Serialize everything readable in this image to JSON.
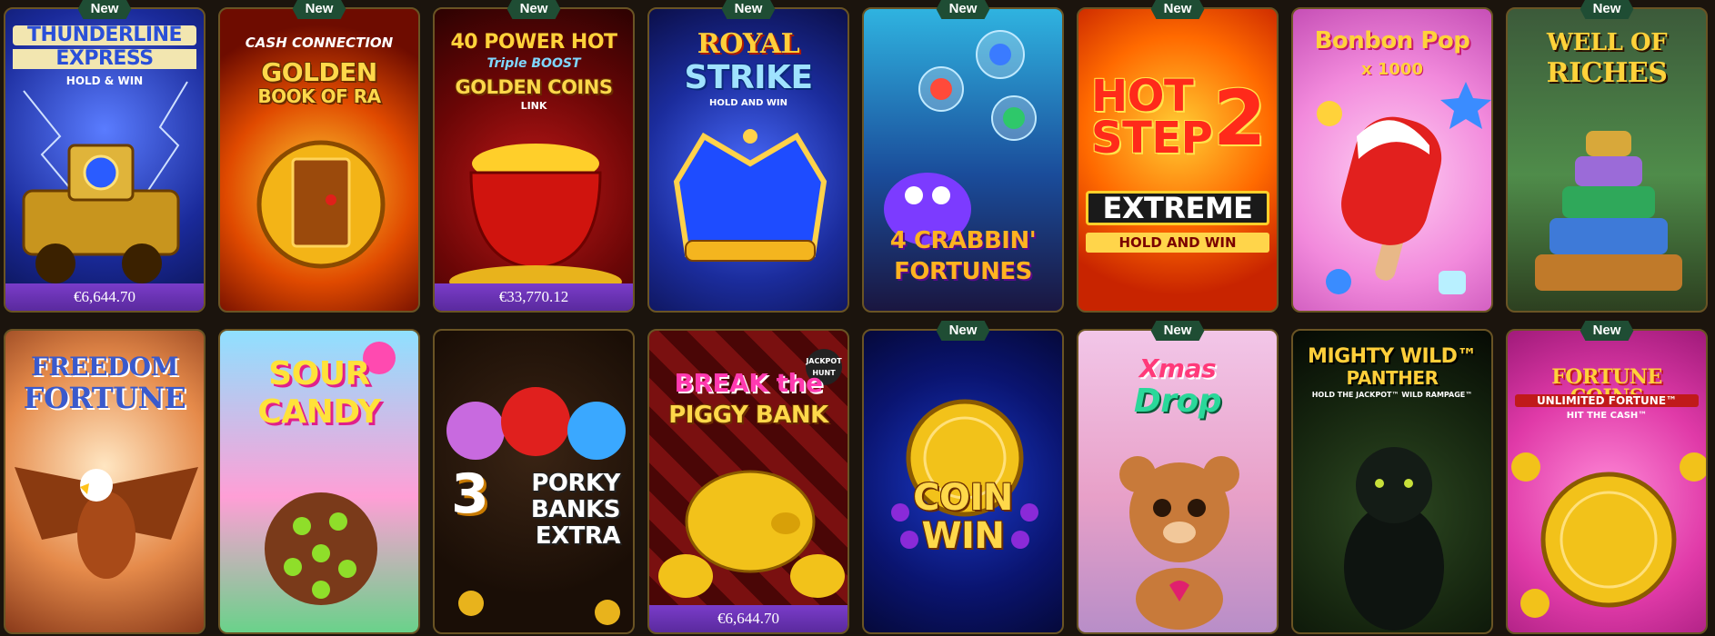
{
  "badge_new": "New",
  "games": [
    {
      "id": "thunderline",
      "title_line1": "THUNDERLINE",
      "title_line2": "EXPRESS",
      "subtitle": "HOLD & WIN",
      "jackpot": "€6,644.70",
      "is_new": true
    },
    {
      "id": "golden-book",
      "title_top": "CASH CONNECTION",
      "title_line1": "GOLDEN",
      "title_line2": "BOOK OF RA",
      "is_new": true
    },
    {
      "id": "power-hot",
      "title_line1": "40 POWER HOT",
      "title_line2": "Triple BOOST",
      "title_line3": "GOLDEN COINS",
      "title_line4": "LINK",
      "jackpot": "€33,770.12",
      "is_new": true
    },
    {
      "id": "royal-strike",
      "title_line1": "ROYAL",
      "title_line2": "STRIKE",
      "subtitle": "HOLD AND WIN",
      "is_new": true
    },
    {
      "id": "crabbin",
      "title_line1": "4 CRABBIN'",
      "title_line2": "FORTUNES",
      "is_new": true
    },
    {
      "id": "hot-step",
      "title_line1": "HOT",
      "title_line2": "STEP",
      "title_num": "2",
      "title_line3": "EXTREME",
      "subtitle": "HOLD AND WIN",
      "is_new": true
    },
    {
      "id": "bonbon",
      "title_line1": "Bonbon Pop",
      "title_line2": "x 1000",
      "is_new": false
    },
    {
      "id": "well-riches",
      "title_line1": "WELL OF",
      "title_line2": "RICHES",
      "is_new": true
    },
    {
      "id": "freedom",
      "title_line1": "FREEDOM",
      "title_line2": "FORTUNE",
      "is_new": false
    },
    {
      "id": "sour-candy",
      "title_line1": "SOUR",
      "title_line2": "CANDY",
      "is_new": false
    },
    {
      "id": "porky",
      "title_num": "3",
      "title_line1": "PORKY",
      "title_line2": "BANKS",
      "title_line3": "EXTRA",
      "is_new": false
    },
    {
      "id": "piggy",
      "title_line1": "BREAK the",
      "title_line2": "PIGGY BANK",
      "corner": "JACKPOT HUNT",
      "jackpot": "€6,644.70",
      "is_new": false
    },
    {
      "id": "coin-win",
      "title_line1": "COIN",
      "title_line2": "WIN",
      "is_new": true
    },
    {
      "id": "xmas",
      "title_line1": "Xmas",
      "title_line2": "Drop",
      "is_new": true
    },
    {
      "id": "mighty-wild",
      "title_line1": "MIGHTY WILD™",
      "title_line2": "PANTHER",
      "subtitle": "HOLD THE JACKPOT™ WILD RAMPAGE™",
      "is_new": false
    },
    {
      "id": "fortune-coins",
      "title_line1": "FORTUNE COINS",
      "title_line2": "UNLIMITED FORTUNE™",
      "subtitle": "HIT THE CASH™",
      "is_new": true
    }
  ]
}
